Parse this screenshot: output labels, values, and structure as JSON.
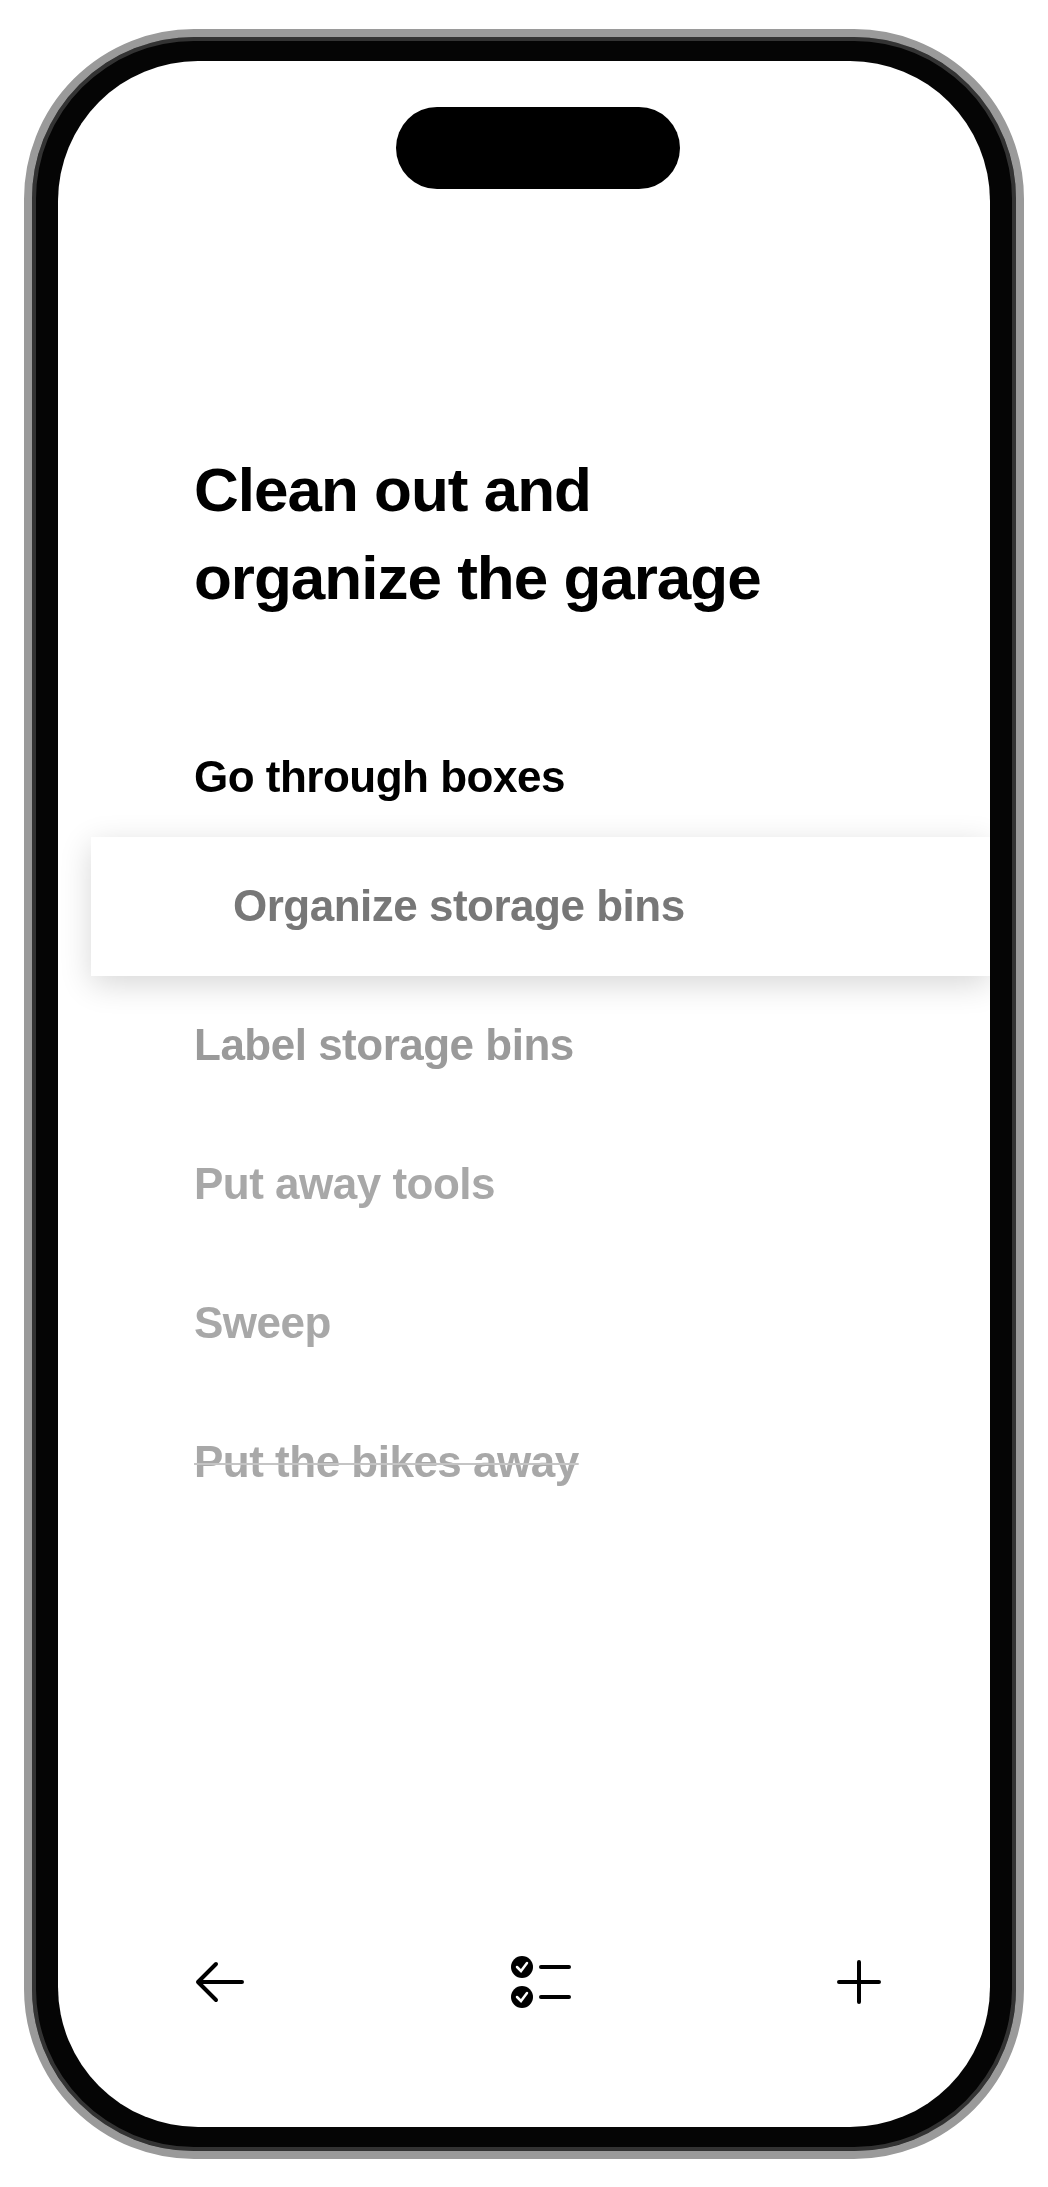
{
  "title": "Clean out and organize the garage",
  "tasks": [
    {
      "label": "Go through boxes",
      "kind": "top",
      "completed": false
    },
    {
      "label": "Organize storage bins",
      "kind": "dragged",
      "completed": false
    },
    {
      "label": "Label storage bins",
      "kind": "near",
      "completed": false
    },
    {
      "label": "Put away tools",
      "kind": "far",
      "completed": false
    },
    {
      "label": "Sweep",
      "kind": "far",
      "completed": false
    },
    {
      "label": "Put the bikes away",
      "kind": "far",
      "completed": true
    }
  ]
}
